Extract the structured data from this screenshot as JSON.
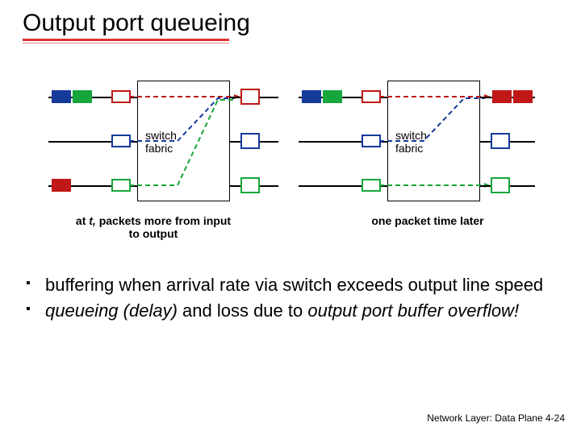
{
  "title": "Output port queueing",
  "diagram": {
    "fabric_label": "switch\nfabric",
    "left_caption_pre": "at ",
    "left_caption_ital": "t,",
    "left_caption_post": " packets more from input to output",
    "right_caption": "one packet time later"
  },
  "bullets": {
    "b1": "buffering when arrival rate via switch exceeds output line speed",
    "b2_pre": "",
    "b2_ital": "queueing (delay)",
    "b2_mid": " and loss due to ",
    "b2_ital2": "output port buffer overflow!"
  },
  "footer": {
    "text": "Network Layer: Data Plane   4-",
    "page": "24"
  },
  "colors": {
    "blue": "#153a9a",
    "green": "#17a63c",
    "red": "#c01717",
    "accent_underline": "#d33"
  }
}
